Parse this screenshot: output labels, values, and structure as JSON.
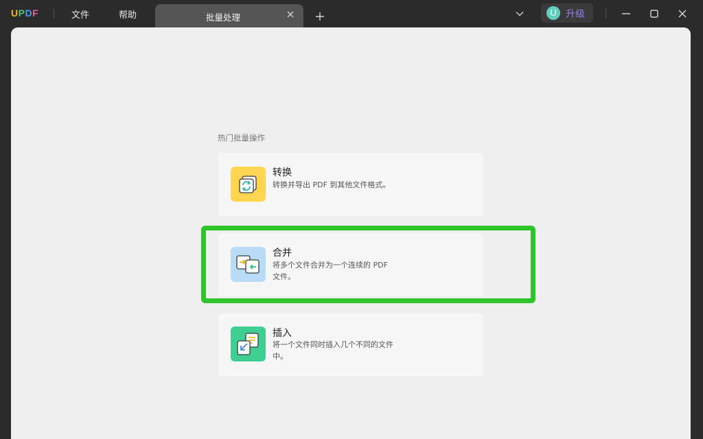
{
  "app": {
    "logo": [
      "U",
      "P",
      "D",
      "F"
    ],
    "menu": {
      "file": "文件",
      "help": "帮助"
    },
    "tab": {
      "title": "批量处理"
    },
    "upgrade": {
      "avatar_letter": "U",
      "label": "升级"
    }
  },
  "main": {
    "section_title": "热门批量操作",
    "cards": [
      {
        "title": "转换",
        "desc": "转换并导出 PDF 到其他文件格式。",
        "icon": "convert-icon",
        "icon_bg": "#ffd44f"
      },
      {
        "title": "合并",
        "desc": "将多个文件合并为一个连续的 PDF 文件。",
        "icon": "merge-icon",
        "icon_bg": "#b8dcf5"
      },
      {
        "title": "插入",
        "desc": "将一个文件同时插入几个不同的文件中。",
        "icon": "insert-icon",
        "icon_bg": "#3fcf93"
      }
    ]
  },
  "colors": {
    "titlebar_bg": "#2b2b2b",
    "content_bg": "#efefef",
    "highlight": "#2ec52b",
    "upgrade_text": "#9b7cf0"
  }
}
